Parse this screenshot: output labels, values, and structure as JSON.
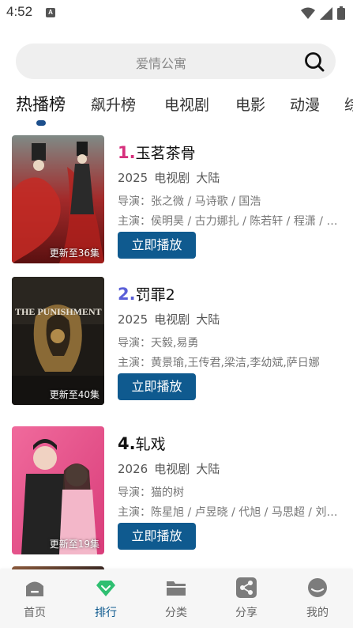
{
  "status_bar": {
    "time": "4:52",
    "notification_badge": "A"
  },
  "search": {
    "placeholder": "爱情公寓"
  },
  "tabs": [
    {
      "label": "热播榜",
      "active": true
    },
    {
      "label": "飙升榜"
    },
    {
      "label": "电视剧"
    },
    {
      "label": "电影"
    },
    {
      "label": "动漫"
    },
    {
      "label": "综"
    }
  ],
  "items": [
    {
      "rank": "1.",
      "rank_color": "#d62f7c",
      "title": "玉茗茶骨",
      "year": "2025",
      "type": "电视剧",
      "region": "大陆",
      "director": "导演：张之微 / 马诗歌 / 国浩",
      "cast": "主演：侯明昊 / 古力娜扎 / 陈若轩 / 程潇 / 王弘毅",
      "badge": "更新至36集",
      "play_label": "立即播放"
    },
    {
      "rank": "2.",
      "rank_color": "#5a5fd8",
      "title": "罚罪2",
      "year": "2025",
      "type": "电视剧",
      "region": "大陆",
      "director": "导演：天毅,易勇",
      "cast": "主演：黄景瑜,王传君,梁洁,李幼斌,萨日娜",
      "badge": "更新至40集",
      "poster_text": "THE PUNISHMENT",
      "play_label": "立即播放"
    },
    {
      "rank": "4.",
      "rank_color": "#111111",
      "title": "轧戏",
      "year": "2026",
      "type": "电视剧",
      "region": "大陆",
      "director": "导演：猫的树",
      "cast": "主演：陈星旭 / 卢昱晓 / 代旭 / 马思超 / 刘奕铁",
      "badge": "更新至19集",
      "play_label": "立即播放"
    }
  ],
  "bottom_nav": [
    {
      "label": "首页",
      "icon": "home-icon"
    },
    {
      "label": "排行",
      "icon": "ranking-diamond-icon",
      "active": true
    },
    {
      "label": "分类",
      "icon": "folder-icon"
    },
    {
      "label": "分享",
      "icon": "share-icon"
    },
    {
      "label": "我的",
      "icon": "profile-icon"
    }
  ],
  "colors": {
    "accent": "#0f5a8f",
    "active_nav_icon": "#2fbf71",
    "indicator": "#1c4f8c"
  }
}
